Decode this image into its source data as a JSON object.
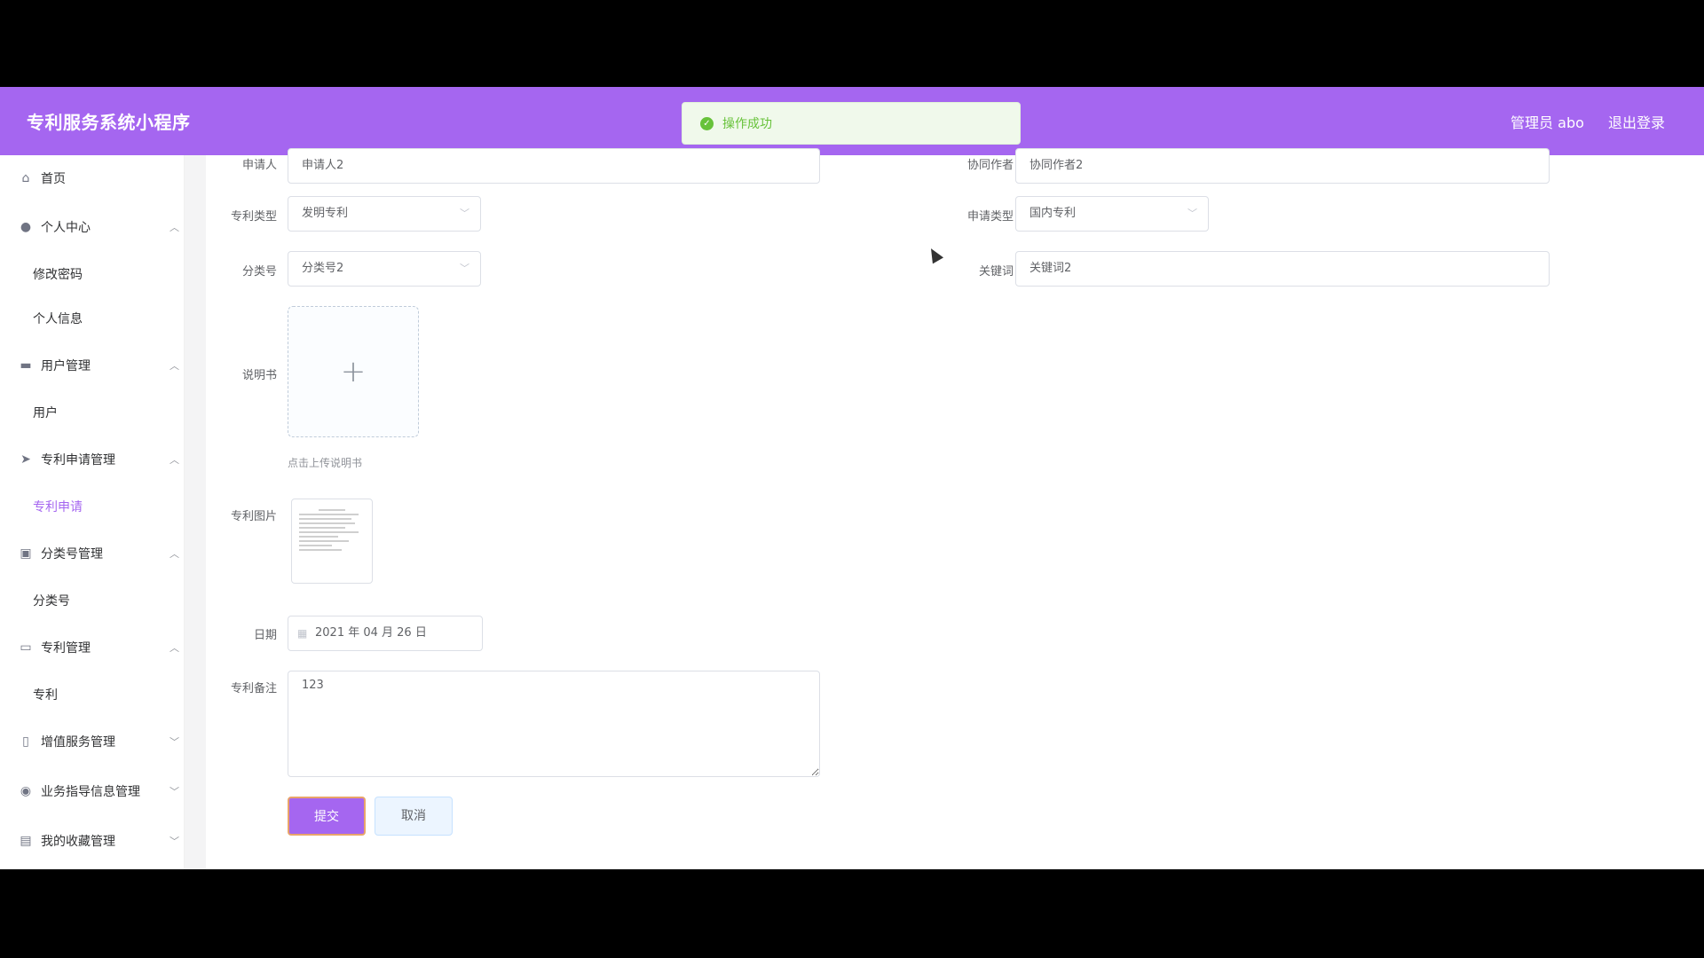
{
  "header": {
    "brand": "专利服务系统小程序",
    "user": "管理员 abo",
    "logout": "退出登录",
    "accent": "#a566f0"
  },
  "toast": {
    "message": "操作成功",
    "icon": "success-check-icon"
  },
  "sidebar": {
    "items": [
      {
        "type": "group",
        "label": "首页",
        "icon": "home-icon"
      },
      {
        "type": "group",
        "label": "个人中心",
        "icon": "user-icon",
        "expanded": true
      },
      {
        "type": "sub",
        "label": "修改密码"
      },
      {
        "type": "sub",
        "label": "个人信息"
      },
      {
        "type": "group",
        "label": "用户管理",
        "icon": "briefcase-icon",
        "expanded": true
      },
      {
        "type": "sub",
        "label": "用户"
      },
      {
        "type": "group",
        "label": "专利申请管理",
        "icon": "paper-plane-icon",
        "expanded": true
      },
      {
        "type": "sub",
        "label": "专利申请",
        "active": true
      },
      {
        "type": "group",
        "label": "分类号管理",
        "icon": "clipboard-icon",
        "expanded": true
      },
      {
        "type": "sub",
        "label": "分类号"
      },
      {
        "type": "group",
        "label": "专利管理",
        "icon": "card-icon",
        "expanded": true
      },
      {
        "type": "sub",
        "label": "专利"
      },
      {
        "type": "group",
        "label": "增值服务管理",
        "icon": "phone-icon",
        "expanded": false
      },
      {
        "type": "group",
        "label": "业务指导信息管理",
        "icon": "location-icon",
        "expanded": false
      },
      {
        "type": "group",
        "label": "我的收藏管理",
        "icon": "document-icon",
        "expanded": false
      }
    ]
  },
  "form": {
    "applicant_label": "申请人",
    "applicant_value": "申请人2",
    "coauthor_label": "协同作者",
    "coauthor_value": "协同作者2",
    "patent_type_label": "专利类型",
    "patent_type_value": "发明专利",
    "apply_type_label": "申请类型",
    "apply_type_value": "国内专利",
    "class_no_label": "分类号",
    "class_no_value": "分类号2",
    "keyword_label": "关键词",
    "keyword_value": "关键词2",
    "manual_label": "说明书",
    "manual_tip": "点击上传说明书",
    "image_label": "专利图片",
    "date_label": "日期",
    "date_value": "2021 年 04 月 26 日",
    "remark_label": "专利备注",
    "remark_value": "123",
    "submit": "提交",
    "cancel": "取消"
  }
}
